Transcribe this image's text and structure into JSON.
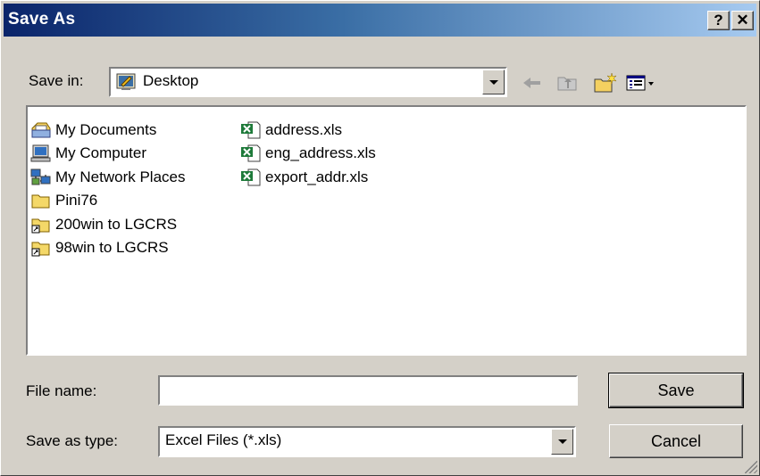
{
  "window": {
    "title": "Save As",
    "help_btn": "?",
    "close_btn": "✕"
  },
  "toolbar": {
    "save_in_label": "Save in:",
    "location": "Desktop",
    "back_icon": "back-arrow-icon",
    "up_icon": "up-folder-icon",
    "new_folder_icon": "new-folder-icon",
    "views_icon": "views-menu-icon"
  },
  "files": {
    "left": [
      {
        "label": "My Documents",
        "icon": "my-documents-icon"
      },
      {
        "label": "My Computer",
        "icon": "my-computer-icon"
      },
      {
        "label": "My Network Places",
        "icon": "network-places-icon"
      },
      {
        "label": "Pini76",
        "icon": "folder-icon"
      },
      {
        "label": "200win to LGCRS",
        "icon": "folder-shortcut-icon"
      },
      {
        "label": "98win to LGCRS",
        "icon": "folder-shortcut-icon"
      }
    ],
    "right": [
      {
        "label": "address.xls",
        "icon": "excel-file-icon"
      },
      {
        "label": "eng_address.xls",
        "icon": "excel-file-icon"
      },
      {
        "label": "export_addr.xls",
        "icon": "excel-file-icon"
      }
    ]
  },
  "form": {
    "file_name_label": "File name:",
    "file_name_value": "",
    "save_type_label": "Save as type:",
    "save_type_value": "Excel Files (*.xls)"
  },
  "buttons": {
    "save": "Save",
    "cancel": "Cancel"
  }
}
